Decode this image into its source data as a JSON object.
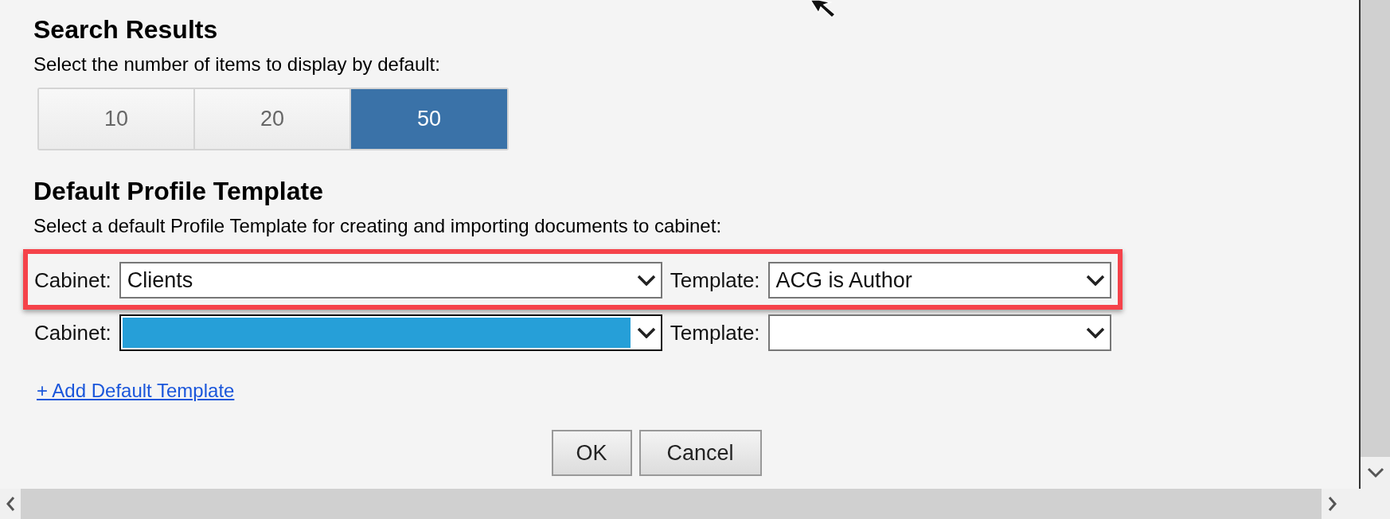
{
  "search_results": {
    "heading": "Search Results",
    "description": "Select the number of items to display by default:",
    "options": [
      {
        "label": "10",
        "selected": false
      },
      {
        "label": "20",
        "selected": false
      },
      {
        "label": "50",
        "selected": true
      }
    ]
  },
  "default_profile_template": {
    "heading": "Default Profile Template",
    "description": "Select a default Profile Template for creating and importing documents to cabinet:",
    "rows": [
      {
        "highlighted": true,
        "cabinet_label": "Cabinet:",
        "cabinet_value": "Clients",
        "cabinet_focused": false,
        "template_label": "Template:",
        "template_value": "ACG is Author"
      },
      {
        "highlighted": false,
        "cabinet_label": "Cabinet:",
        "cabinet_focused": true,
        "template_label": "Template:"
      }
    ],
    "add_link": "+ Add Default Template"
  },
  "buttons": [
    {
      "label": "OK"
    },
    {
      "label": "Cancel"
    }
  ]
}
